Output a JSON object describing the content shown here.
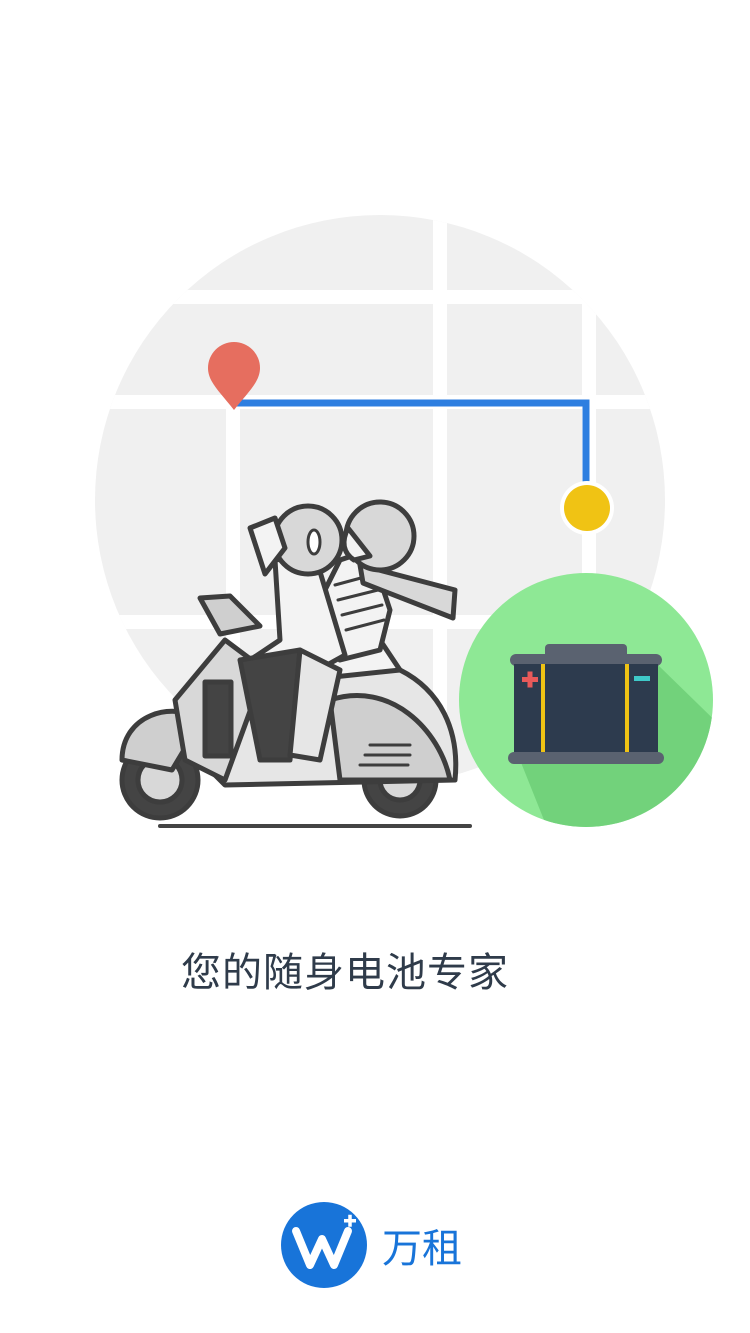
{
  "tagline": "您的随身电池专家",
  "brand": {
    "name": "万租",
    "logo_letter": "W",
    "logo_mark": "+"
  },
  "colors": {
    "map_bg": "#f0f0f0",
    "route": "#2d7ee0",
    "pin": "#e66e5f",
    "dot": "#f0c314",
    "battery_circle": "#8ee895",
    "battery_shadow": "#72d27b",
    "battery_body": "#2d3b4e",
    "brand": "#1874d9"
  },
  "icons": [
    "location-pin-icon",
    "destination-dot-icon",
    "battery-icon",
    "brand-logo-icon"
  ]
}
